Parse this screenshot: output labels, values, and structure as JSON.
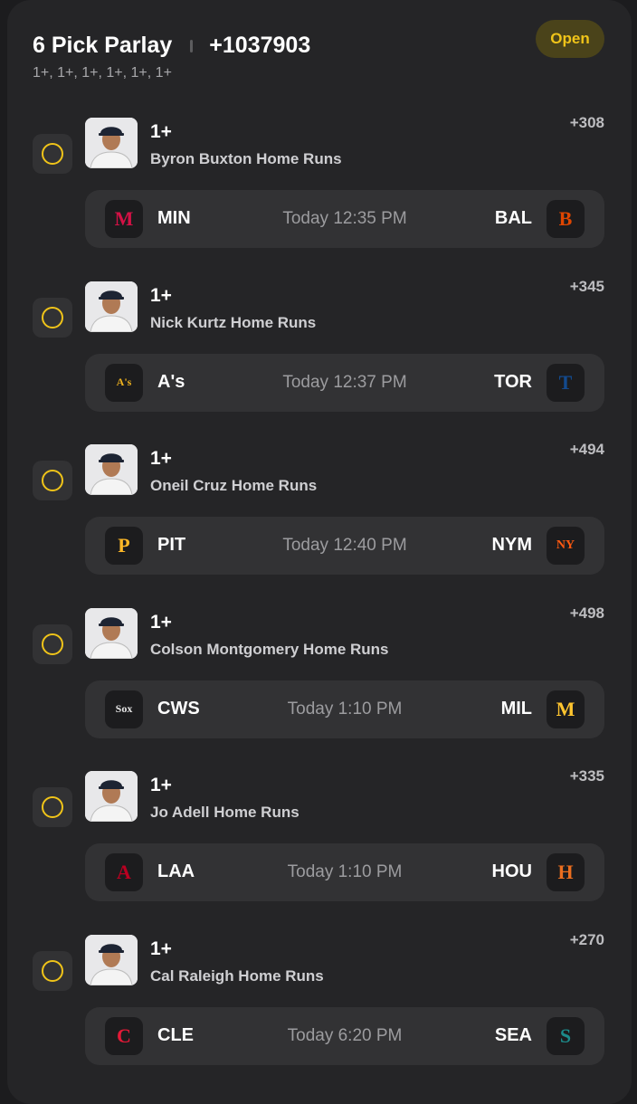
{
  "header": {
    "title": "6 Pick Parlay",
    "total_odds": "+1037903",
    "subtitle": "1+, 1+, 1+, 1+, 1+, 1+",
    "status": "Open"
  },
  "colors": {
    "accent": "#f0c419",
    "card": "#252527",
    "chip": "#323234"
  },
  "legs": [
    {
      "line": "1+",
      "market": "Byron Buxton Home Runs",
      "odds": "+308",
      "away": {
        "abbr": "MIN",
        "icon": "twins-logo-icon",
        "color": "#d31145",
        "mark": "M"
      },
      "time": "Today 12:35 PM",
      "home": {
        "abbr": "BAL",
        "icon": "orioles-logo-icon",
        "color": "#df4601",
        "mark": "B"
      }
    },
    {
      "line": "1+",
      "market": "Nick Kurtz Home Runs",
      "odds": "+345",
      "away": {
        "abbr": "A's",
        "icon": "athletics-logo-icon",
        "color": "#efb21e",
        "mark": "A's"
      },
      "time": "Today 12:37 PM",
      "home": {
        "abbr": "TOR",
        "icon": "blue-jays-logo-icon",
        "color": "#134a8e",
        "mark": "T"
      }
    },
    {
      "line": "1+",
      "market": "Oneil Cruz Home Runs",
      "odds": "+494",
      "away": {
        "abbr": "PIT",
        "icon": "pirates-logo-icon",
        "color": "#fdb827",
        "mark": "P"
      },
      "time": "Today 12:40 PM",
      "home": {
        "abbr": "NYM",
        "icon": "mets-logo-icon",
        "color": "#ff5910",
        "mark": "NY"
      }
    },
    {
      "line": "1+",
      "market": "Colson Montgomery Home Runs",
      "odds": "+498",
      "away": {
        "abbr": "CWS",
        "icon": "white-sox-logo-icon",
        "color": "#e6e6e6",
        "mark": "Sox"
      },
      "time": "Today 1:10 PM",
      "home": {
        "abbr": "MIL",
        "icon": "brewers-logo-icon",
        "color": "#ffc52f",
        "mark": "M"
      }
    },
    {
      "line": "1+",
      "market": "Jo Adell Home Runs",
      "odds": "+335",
      "away": {
        "abbr": "LAA",
        "icon": "angels-logo-icon",
        "color": "#ba0021",
        "mark": "A"
      },
      "time": "Today 1:10 PM",
      "home": {
        "abbr": "HOU",
        "icon": "astros-logo-icon",
        "color": "#eb6e1f",
        "mark": "H"
      }
    },
    {
      "line": "1+",
      "market": "Cal Raleigh Home Runs",
      "odds": "+270",
      "away": {
        "abbr": "CLE",
        "icon": "guardians-logo-icon",
        "color": "#e31937",
        "mark": "C"
      },
      "time": "Today 6:20 PM",
      "home": {
        "abbr": "SEA",
        "icon": "mariners-logo-icon",
        "color": "#1c8b8b",
        "mark": "S"
      }
    }
  ]
}
